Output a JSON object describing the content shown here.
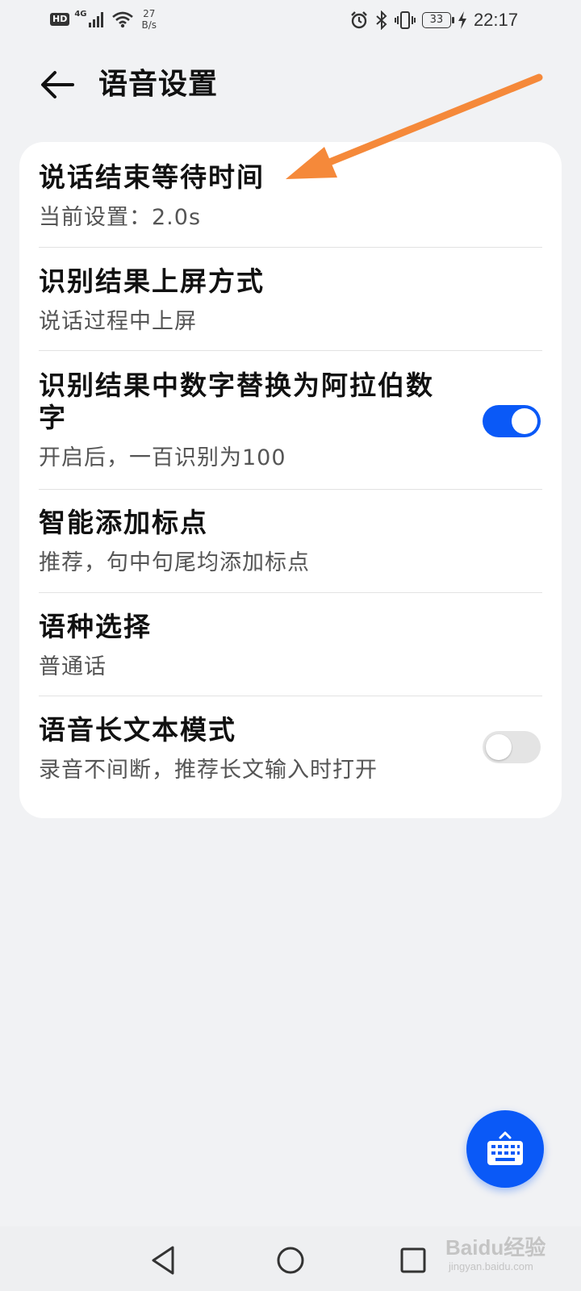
{
  "status_bar": {
    "hd_badge": "HD",
    "network_type": "4G",
    "speed_value": "27",
    "speed_unit": "B/s",
    "battery": "33",
    "time": "22:17"
  },
  "header": {
    "title": "语音设置"
  },
  "settings": [
    {
      "title": "说话结束等待时间",
      "subtitle": "当前设置：2.0s"
    },
    {
      "title": "识别结果上屏方式",
      "subtitle": "说话过程中上屏"
    },
    {
      "title_line1": "识别结果中数字替换为阿拉伯数",
      "title_line2": "字",
      "subtitle": "开启后，一百识别为100",
      "toggle_on": true
    },
    {
      "title": "智能添加标点",
      "subtitle": "推荐，句中句尾均添加标点"
    },
    {
      "title": "语种选择",
      "subtitle": "普通话"
    },
    {
      "title": "语音长文本模式",
      "subtitle": "录音不间断，推荐长文输入时打开",
      "toggle_on": false
    }
  ],
  "colors": {
    "accent": "#0a59f7",
    "annotation_arrow": "#f5893a",
    "background": "#f1f2f4"
  },
  "fab": {
    "icon": "keyboard-icon"
  },
  "watermark": {
    "brand": "Baidu经验",
    "url": "jingyan.baidu.com"
  }
}
